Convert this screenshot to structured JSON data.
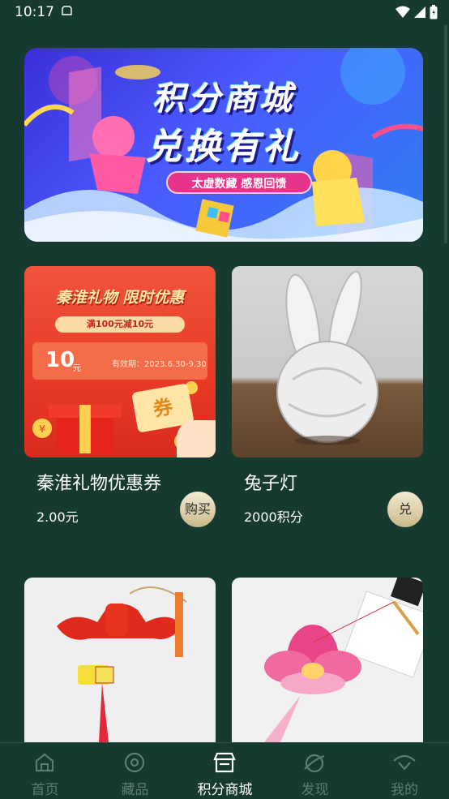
{
  "status_bar": {
    "time": "10:17"
  },
  "banner": {
    "title_line1": "积分商城",
    "title_line2": "兑换有礼",
    "tagline": "太虚数藏  感恩回馈"
  },
  "products": [
    {
      "name": "秦淮礼物优惠券",
      "price": "2.00元",
      "action_label": "购买",
      "image_text": {
        "title": "秦淮礼物 限时优惠",
        "subtitle": "满100元减10元",
        "amount": "10",
        "unit": "元",
        "validity": "有效期：2023.6.30-9.30",
        "ticket_glyph": "券"
      }
    },
    {
      "name": "兔子灯",
      "price": "2000积分",
      "action_label": "兑"
    }
  ],
  "bottom_nav": {
    "items": [
      {
        "label": "首页",
        "icon": "home-icon"
      },
      {
        "label": "藏品",
        "icon": "collection-icon"
      },
      {
        "label": "积分商城",
        "icon": "store-icon",
        "active": true
      },
      {
        "label": "发现",
        "icon": "planet-icon"
      },
      {
        "label": "我的",
        "icon": "profile-icon"
      }
    ],
    "colors": {
      "active": "#ffffff",
      "inactive": "#5d7d72"
    }
  }
}
